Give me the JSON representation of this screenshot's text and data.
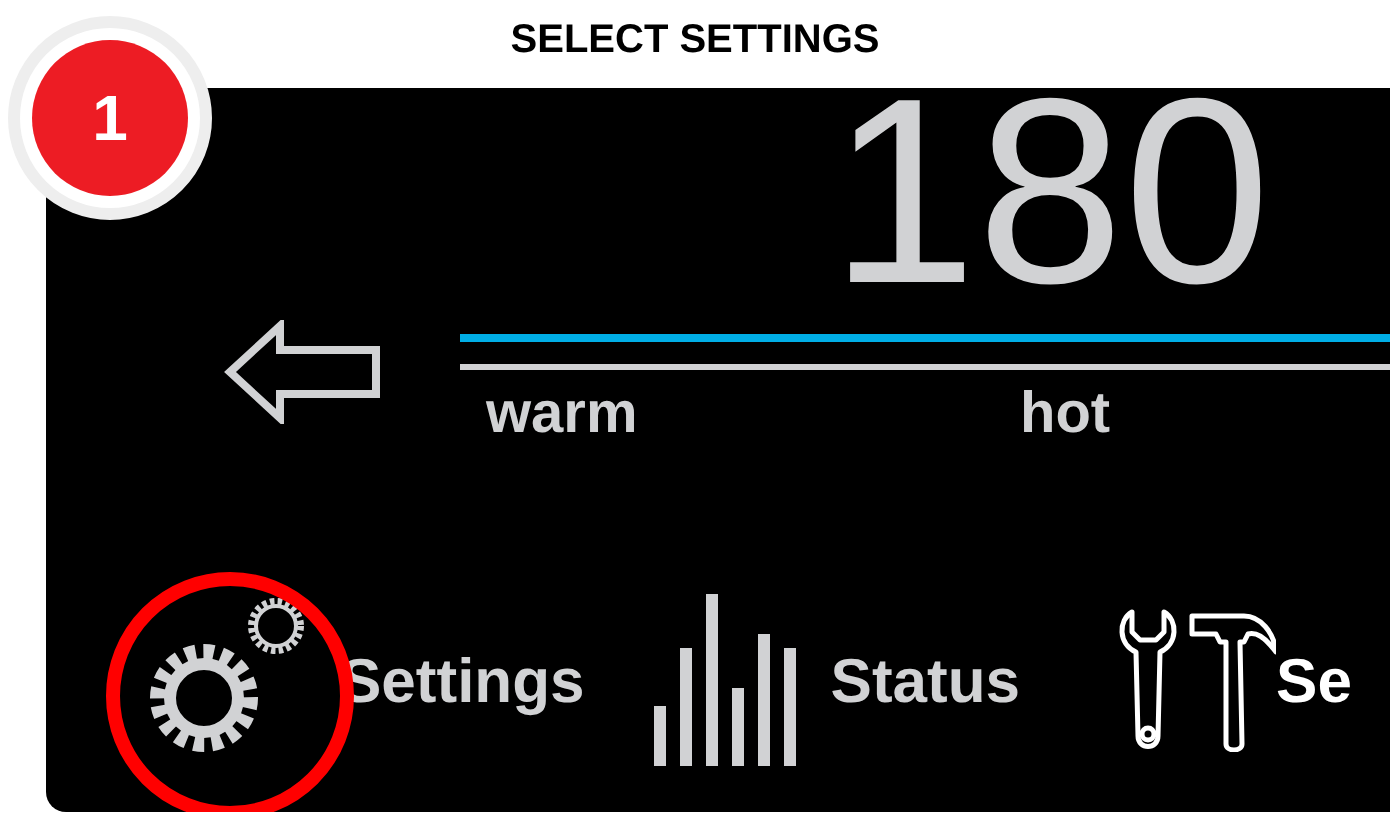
{
  "title": "SELECT SETTINGS",
  "step_badge": "1",
  "temperature": "180",
  "scale_labels": [
    "warm",
    "hot"
  ],
  "menu": [
    {
      "kind": "settings",
      "label": "Settings",
      "highlighted": true
    },
    {
      "kind": "status",
      "label": "Status",
      "highlighted": false
    },
    {
      "kind": "service",
      "label": "Se",
      "highlighted": false
    }
  ]
}
